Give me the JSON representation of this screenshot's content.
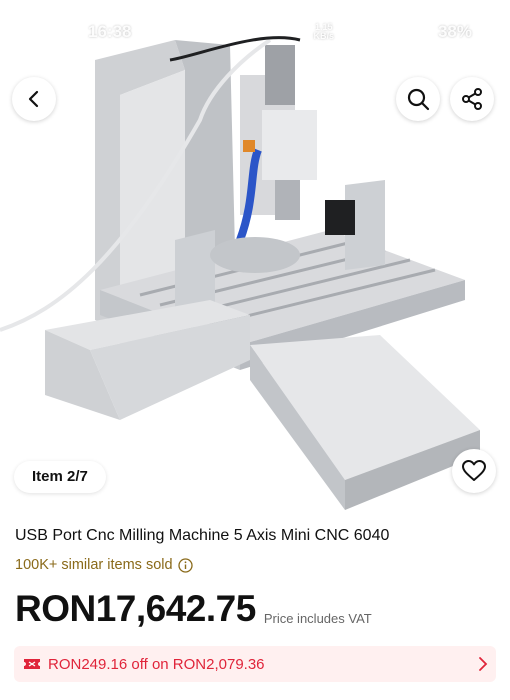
{
  "status_bar": {
    "time": "16:38",
    "speed_value": "1.15",
    "speed_unit": "KB/s",
    "battery": "38%"
  },
  "product": {
    "title": "USB Port Cnc Milling Machine 5 Axis Mini CNC 6040",
    "sold_text": "100K+ similar items sold",
    "price": "RON17,642.75",
    "price_note": "Price includes VAT",
    "item_indicator": "Item 2/7"
  },
  "promo": {
    "text": "RON249.16 off on RON2,079.36"
  },
  "colors": {
    "accent_red": "#e0243a",
    "sold_text": "#8a6a1a",
    "promo_bg": "#fff0f0"
  },
  "icons": [
    "back-arrow-icon",
    "search-icon",
    "share-icon",
    "heart-icon",
    "info-icon",
    "coupon-tag-icon",
    "chevron-right-icon"
  ]
}
